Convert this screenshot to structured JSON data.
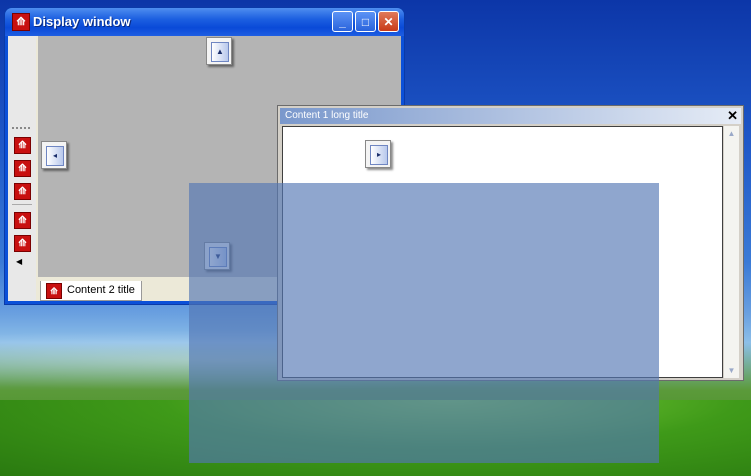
{
  "display_window": {
    "title": "Display window",
    "app_icon": "app-red-icon",
    "controls": {
      "minimize": "_",
      "maximize": "□",
      "close": "✕"
    },
    "tab": {
      "label": "Content 2 title"
    }
  },
  "floating_window": {
    "title": "Content 1 long title",
    "close": "✕"
  },
  "dock_guides": {
    "top": "▲",
    "left": "◂",
    "right": "▸",
    "bottom": "▼"
  },
  "colors": {
    "title_bar": "#0a4ad8",
    "dock_overlay": "#5376b4",
    "icon_red": "#c81010"
  }
}
